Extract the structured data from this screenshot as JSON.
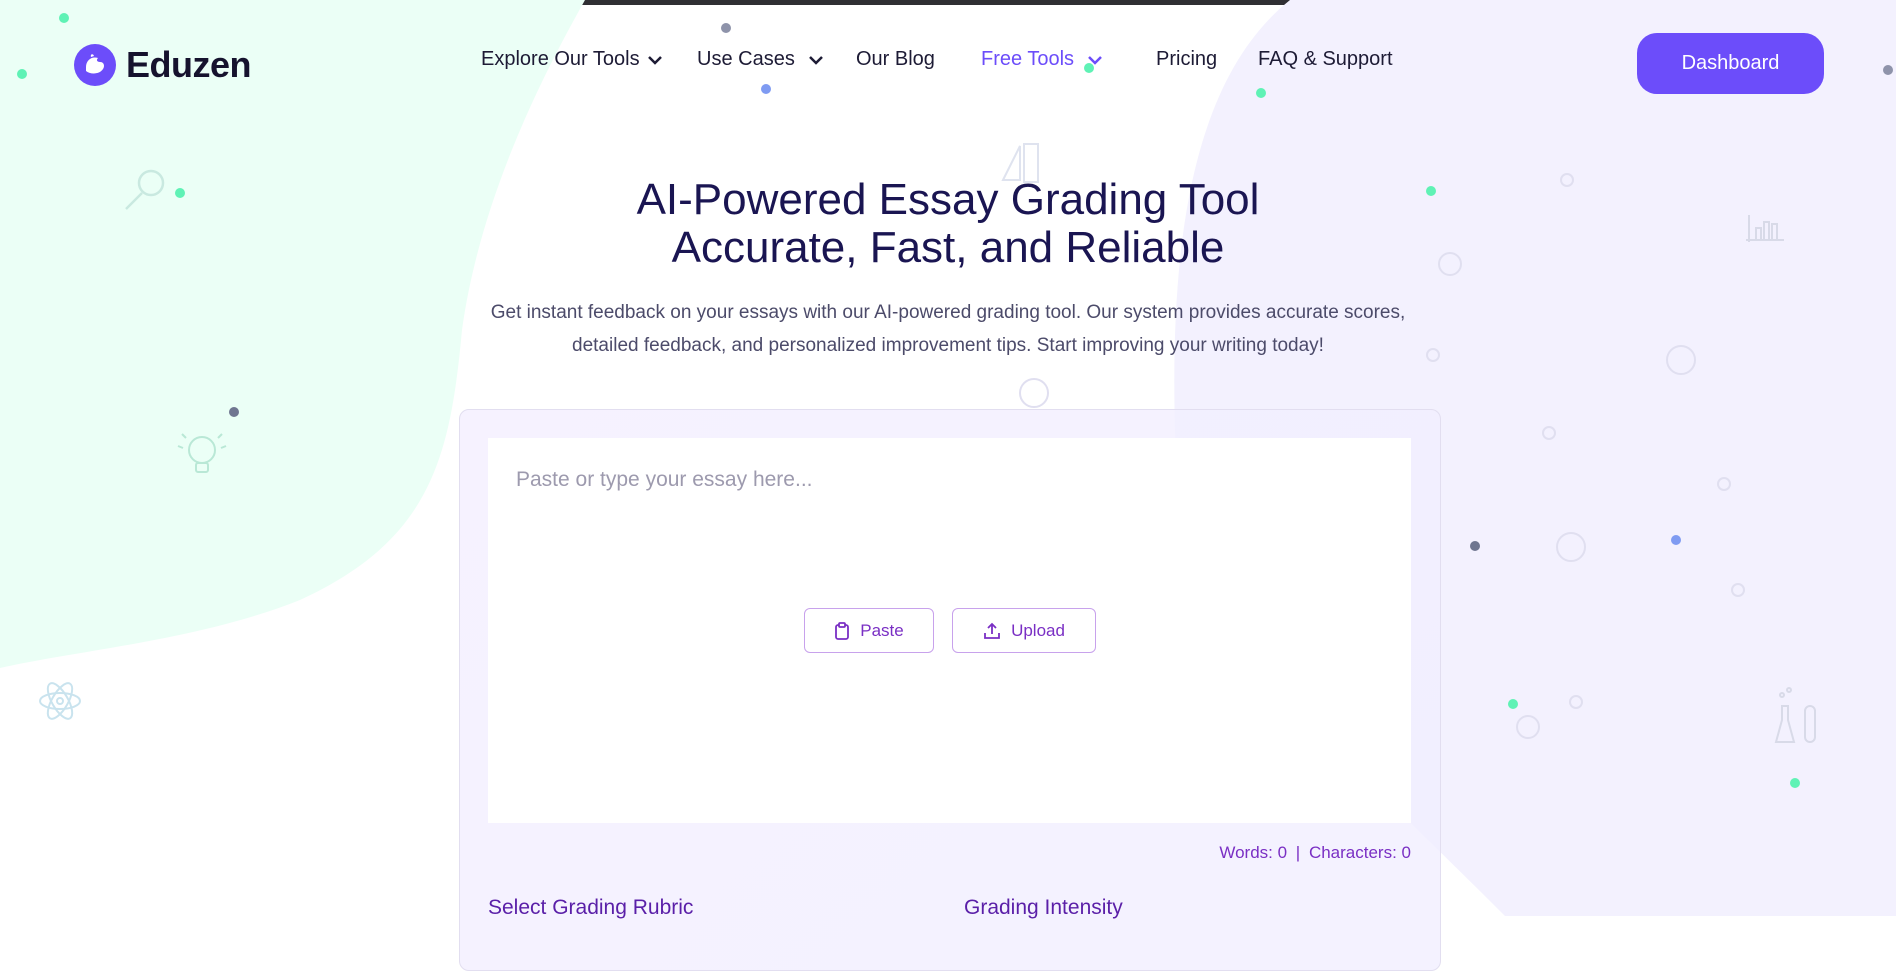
{
  "header": {
    "logo_text": "Eduzen",
    "nav": [
      {
        "label": "Explore Our Tools",
        "has_dropdown": true
      },
      {
        "label": "Use Cases",
        "has_dropdown": true
      },
      {
        "label": "Our Blog",
        "has_dropdown": false
      },
      {
        "label": "Free Tools",
        "has_dropdown": true,
        "active": true
      },
      {
        "label": "Pricing",
        "has_dropdown": false
      },
      {
        "label": "FAQ & Support",
        "has_dropdown": false
      }
    ],
    "dashboard_label": "Dashboard"
  },
  "hero": {
    "title_line1": "AI-Powered Essay Grading Tool",
    "title_line2": "Accurate, Fast, and Reliable",
    "subtitle_line1": "Get instant feedback on your essays with our AI-powered grading tool. Our system provides accurate scores,",
    "subtitle_line2": "detailed feedback, and personalized improvement tips. Start improving your writing today!"
  },
  "editor": {
    "placeholder": "Paste or type your essay here...",
    "paste_label": "Paste",
    "upload_label": "Upload",
    "words_label": "Words: 0",
    "separator": "|",
    "chars_label": "Characters: 0"
  },
  "sections": {
    "rubric_label": "Select Grading Rubric",
    "intensity_label": "Grading Intensity"
  },
  "colors": {
    "accent": "#6c4dfa",
    "accent_text": "#7a2fc4",
    "heading": "#1a1552",
    "mint_blob": "#eafff5",
    "lavender_blob": "#f3f1ff"
  },
  "icons": [
    "logo-bird-icon",
    "chevron-down-icon",
    "clipboard-icon",
    "upload-icon",
    "magnifier-icon",
    "lightbulb-icon",
    "atom-icon",
    "ai-ruler-icon",
    "bar-chart-icon",
    "test-tubes-icon"
  ]
}
